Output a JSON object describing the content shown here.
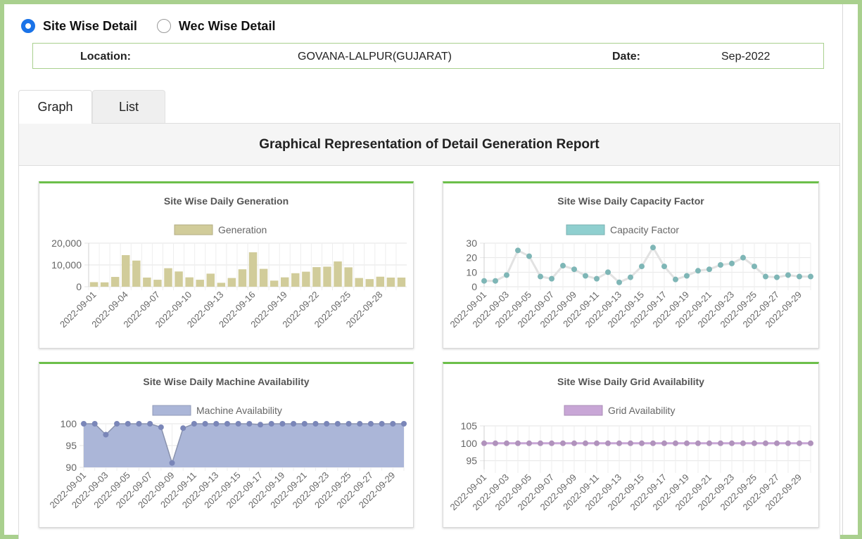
{
  "view_options": {
    "site_wise": "Site Wise Detail",
    "wec_wise": "Wec Wise Detail",
    "selected": "site_wise"
  },
  "info": {
    "location_label": "Location:",
    "location_value": "GOVANA-LALPUR(GUJARAT)",
    "date_label": "Date:",
    "date_value": "Sep-2022"
  },
  "tabs": {
    "graph": "Graph",
    "list": "List",
    "active": "graph"
  },
  "panel_title": "Graphical Representation of Detail Generation Report",
  "chart_data": [
    {
      "type": "bar",
      "title": "Site Wise Daily Generation",
      "legend": "Generation",
      "color": "#d1cc9a",
      "ylim": [
        0,
        20000
      ],
      "yticks": [
        0,
        10000,
        20000
      ],
      "ytick_labels": [
        "0",
        "10,000",
        "20,000"
      ],
      "categories": [
        "2022-09-01",
        "2022-09-02",
        "2022-09-03",
        "2022-09-04",
        "2022-09-05",
        "2022-09-06",
        "2022-09-07",
        "2022-09-08",
        "2022-09-09",
        "2022-09-10",
        "2022-09-11",
        "2022-09-12",
        "2022-09-13",
        "2022-09-14",
        "2022-09-15",
        "2022-09-16",
        "2022-09-17",
        "2022-09-18",
        "2022-09-19",
        "2022-09-20",
        "2022-09-21",
        "2022-09-22",
        "2022-09-23",
        "2022-09-24",
        "2022-09-25",
        "2022-09-26",
        "2022-09-27",
        "2022-09-28",
        "2022-09-29",
        "2022-09-30"
      ],
      "xtick_labels": [
        "2022-09-01",
        "2022-09-04",
        "2022-09-07",
        "2022-09-10",
        "2022-09-13",
        "2022-09-16",
        "2022-09-19",
        "2022-09-22",
        "2022-09-25",
        "2022-09-28"
      ],
      "values": [
        2100,
        2000,
        4500,
        14500,
        12000,
        4200,
        3200,
        8500,
        7000,
        4300,
        3200,
        6000,
        1800,
        4000,
        8000,
        15800,
        8200,
        2800,
        4300,
        6200,
        6900,
        9000,
        9200,
        11600,
        8900,
        4000,
        3500,
        4600,
        4200,
        4200
      ]
    },
    {
      "type": "line",
      "title": "Site Wise Daily Capacity Factor",
      "legend": "Capacity Factor",
      "color": "#8fcfcf",
      "ylim": [
        0,
        30
      ],
      "yticks": [
        0,
        10,
        20,
        30
      ],
      "ytick_labels": [
        "0",
        "10",
        "20",
        "30"
      ],
      "categories": [
        "2022-09-01",
        "2022-09-02",
        "2022-09-03",
        "2022-09-04",
        "2022-09-05",
        "2022-09-06",
        "2022-09-07",
        "2022-09-08",
        "2022-09-09",
        "2022-09-10",
        "2022-09-11",
        "2022-09-12",
        "2022-09-13",
        "2022-09-14",
        "2022-09-15",
        "2022-09-16",
        "2022-09-17",
        "2022-09-18",
        "2022-09-19",
        "2022-09-20",
        "2022-09-21",
        "2022-09-22",
        "2022-09-23",
        "2022-09-24",
        "2022-09-25",
        "2022-09-26",
        "2022-09-27",
        "2022-09-28",
        "2022-09-29",
        "2022-09-30"
      ],
      "xtick_labels": [
        "2022-09-01",
        "2022-09-03",
        "2022-09-05",
        "2022-09-07",
        "2022-09-09",
        "2022-09-11",
        "2022-09-13",
        "2022-09-15",
        "2022-09-17",
        "2022-09-19",
        "2022-09-21",
        "2022-09-23",
        "2022-09-25",
        "2022-09-27",
        "2022-09-29"
      ],
      "values": [
        4,
        4,
        8,
        25,
        21,
        7,
        5.5,
        14.5,
        12,
        7.5,
        5.5,
        10,
        3,
        6.5,
        14,
        27,
        14,
        5,
        7.5,
        11,
        12,
        15,
        16,
        20,
        14,
        7,
        6.5,
        8,
        7,
        7
      ]
    },
    {
      "type": "area",
      "title": "Site Wise Daily Machine Availability",
      "legend": "Machine Availability",
      "color": "#abb6d8",
      "ylim": [
        90,
        100
      ],
      "yticks": [
        90,
        95,
        100
      ],
      "ytick_labels": [
        "90",
        "95",
        "100"
      ],
      "categories": [
        "2022-09-01",
        "2022-09-02",
        "2022-09-03",
        "2022-09-04",
        "2022-09-05",
        "2022-09-06",
        "2022-09-07",
        "2022-09-08",
        "2022-09-09",
        "2022-09-10",
        "2022-09-11",
        "2022-09-12",
        "2022-09-13",
        "2022-09-14",
        "2022-09-15",
        "2022-09-16",
        "2022-09-17",
        "2022-09-18",
        "2022-09-19",
        "2022-09-20",
        "2022-09-21",
        "2022-09-22",
        "2022-09-23",
        "2022-09-24",
        "2022-09-25",
        "2022-09-26",
        "2022-09-27",
        "2022-09-28",
        "2022-09-29",
        "2022-09-30"
      ],
      "xtick_labels": [
        "2022-09-01",
        "2022-09-03",
        "2022-09-05",
        "2022-09-07",
        "2022-09-09",
        "2022-09-11",
        "2022-09-13",
        "2022-09-15",
        "2022-09-17",
        "2022-09-19",
        "2022-09-21",
        "2022-09-23",
        "2022-09-25",
        "2022-09-27",
        "2022-09-29"
      ],
      "values": [
        100,
        100,
        97.5,
        100,
        100,
        100,
        100,
        99.2,
        91,
        99,
        100,
        100,
        100,
        100,
        100,
        100,
        99.8,
        100,
        100,
        100,
        100,
        100,
        100,
        100,
        100,
        100,
        100,
        100,
        100,
        100
      ]
    },
    {
      "type": "line",
      "title": "Site Wise Daily Grid Availability",
      "legend": "Grid Availability",
      "color": "#c8a6d6",
      "ylim": [
        92.5,
        105
      ],
      "yticks": [
        95,
        100,
        105
      ],
      "ytick_labels": [
        "95",
        "100",
        "105"
      ],
      "categories": [
        "2022-09-01",
        "2022-09-02",
        "2022-09-03",
        "2022-09-04",
        "2022-09-05",
        "2022-09-06",
        "2022-09-07",
        "2022-09-08",
        "2022-09-09",
        "2022-09-10",
        "2022-09-11",
        "2022-09-12",
        "2022-09-13",
        "2022-09-14",
        "2022-09-15",
        "2022-09-16",
        "2022-09-17",
        "2022-09-18",
        "2022-09-19",
        "2022-09-20",
        "2022-09-21",
        "2022-09-22",
        "2022-09-23",
        "2022-09-24",
        "2022-09-25",
        "2022-09-26",
        "2022-09-27",
        "2022-09-28",
        "2022-09-29",
        "2022-09-30"
      ],
      "xtick_labels": [
        "2022-09-01",
        "2022-09-03",
        "2022-09-05",
        "2022-09-07",
        "2022-09-09",
        "2022-09-11",
        "2022-09-13",
        "2022-09-15",
        "2022-09-17",
        "2022-09-19",
        "2022-09-21",
        "2022-09-23",
        "2022-09-25",
        "2022-09-27",
        "2022-09-29"
      ],
      "values": [
        100,
        100,
        100,
        100,
        100,
        100,
        100,
        100,
        100,
        100,
        100,
        100,
        100,
        100,
        100,
        100,
        100,
        100,
        100,
        100,
        100,
        100,
        100,
        100,
        100,
        100,
        100,
        100,
        100,
        100
      ]
    }
  ]
}
